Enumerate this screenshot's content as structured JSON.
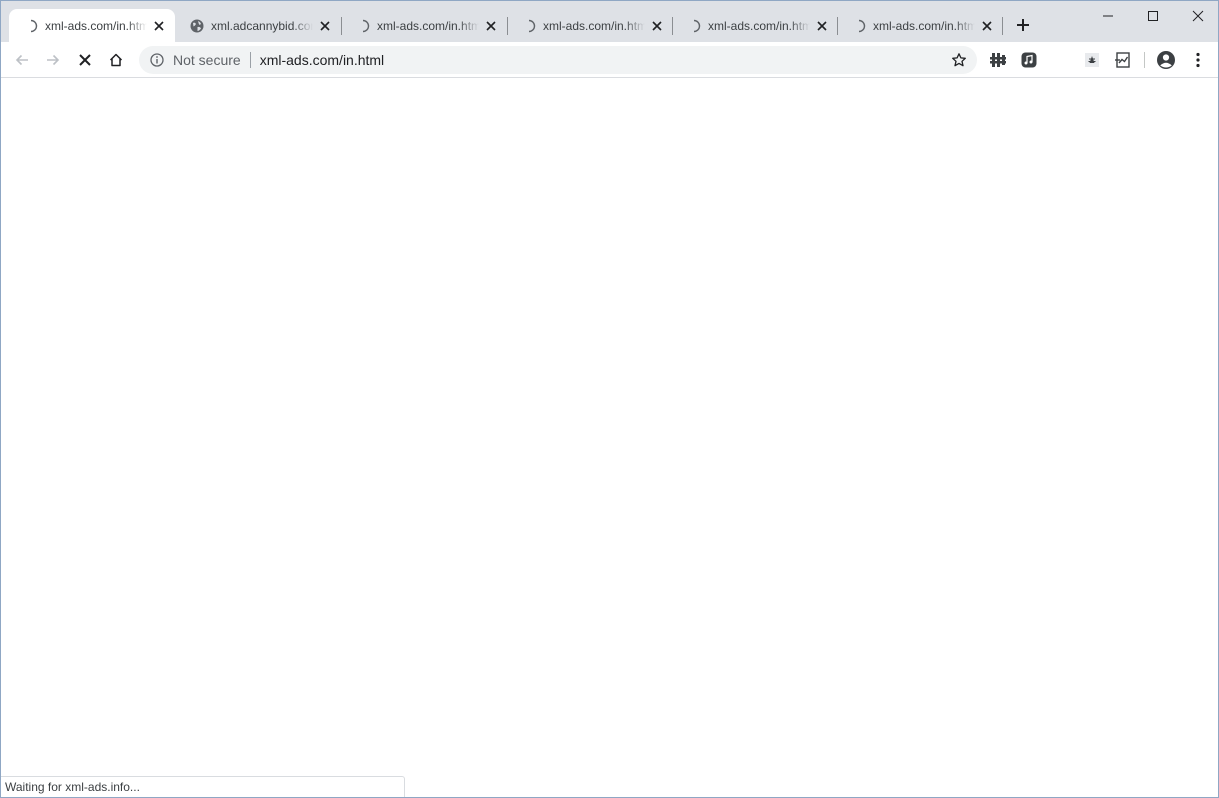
{
  "browser": {
    "tabs": [
      {
        "title": "xml-ads.com/in.html",
        "favicon": "loading-spinner-icon",
        "active": true
      },
      {
        "title": "xml.adcannybid.com",
        "favicon": "globe-icon",
        "active": false
      },
      {
        "title": "xml-ads.com/in.html",
        "favicon": "loading-spinner-icon",
        "active": false
      },
      {
        "title": "xml-ads.com/in.html",
        "favicon": "loading-spinner-icon",
        "active": false
      },
      {
        "title": "xml-ads.com/in.html",
        "favicon": "loading-spinner-icon",
        "active": false
      },
      {
        "title": "xml-ads.com/in.html",
        "favicon": "loading-spinner-icon",
        "active": false
      }
    ],
    "omnibox": {
      "security_label": "Not secure",
      "url": "xml-ads.com/in.html"
    },
    "status_text": "Waiting for xml-ads.info...",
    "colors": {
      "tabstrip": "#dee1e6",
      "active_tab": "#ffffff",
      "omnibox": "#f1f3f4",
      "window_border": "#8fa7c4"
    },
    "icons": {
      "back": "back-arrow-icon",
      "forward": "forward-arrow-icon",
      "stop": "stop-loading-icon",
      "home": "home-icon",
      "info": "info-icon",
      "bookmark": "star-icon",
      "extensions": [
        "puzzle-extension-icon",
        "music-extension-icon",
        "bug-extension-icon",
        "chart-extension-icon"
      ],
      "profile": "profile-icon",
      "menu": "kebab-menu-icon"
    }
  }
}
